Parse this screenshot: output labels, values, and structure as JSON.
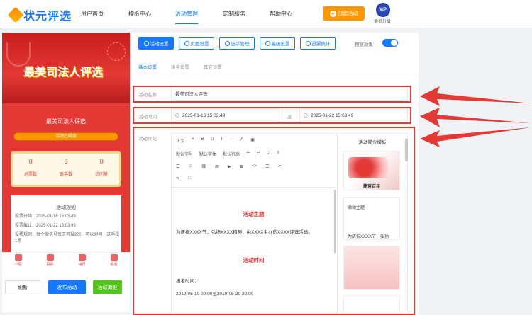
{
  "brand": {
    "name": "状元评选"
  },
  "nav": [
    "用户首页",
    "模板中心",
    "活动管理",
    "定制服务",
    "帮助中心"
  ],
  "header": {
    "create_label": "创建活动",
    "vip_badge": "VIP",
    "vip_label": "会员升级"
  },
  "preview": {
    "banner_title": "最美司法人评选",
    "card_title": "最美司法人评选",
    "status": "活动已结束",
    "stats": [
      {
        "value": "0",
        "label": "总票数"
      },
      {
        "value": "6",
        "label": "选手数"
      },
      {
        "value": "0",
        "label": "访问量"
      }
    ],
    "rules_title": "活动规则",
    "rules": [
      "投票开始：2025-01-16 15:03:49",
      "投票截止：2025-01-22 15:03:49",
      "投票规则：每个微信号每天可投2次，可以对同一选手投1票"
    ],
    "tabs": [
      "介绍",
      "投票",
      "排行",
      "报名"
    ],
    "buttons": {
      "refresh": "刷新",
      "publish": "发布活动",
      "poster": "活动海报"
    }
  },
  "toolbar": {
    "buttons": [
      "活动设置",
      "页面设置",
      "选手管理",
      "高级设置",
      "投票统计"
    ],
    "preview_toggle": "预览效果"
  },
  "subtabs": [
    "基本设置",
    "报名设置",
    "其它设置"
  ],
  "form": {
    "name_label": "活动名称",
    "name_value": "最美司法人评选",
    "time_label": "活动时间",
    "start_time": "2025-01-16 15:03:49",
    "separator": "至",
    "end_time": "2025-01-22 15:03:49",
    "intro_label": "活动介绍"
  },
  "rte": {
    "row1": [
      "正文",
      "❝",
      "B",
      "U",
      "I",
      "···",
      "A",
      "▣"
    ],
    "row2": [
      "默认字号",
      "默认字体",
      "默认行高",
      "☰",
      "☷",
      "☑",
      "≡"
    ],
    "row3": [
      "☰",
      "☺",
      "⛓",
      "▨",
      "▶",
      "▦",
      "<>",
      "☲",
      "↶"
    ],
    "row4": [
      "↷",
      "⛶"
    ],
    "heading1": "活动主题",
    "para1": "为庆祝XXXX节，弘扬XXXX精神，由XXXX主办的XXXX评选活动。",
    "heading2": "活动时间",
    "para2": "报名时间：",
    "para3": "2019-05-10 00:00至2019-05-20 20:00"
  },
  "templates": {
    "title": "活动简介模板",
    "tpl1_caption": "建营百年",
    "tpl2_title": "活动主题",
    "tpl2_body": "为庆祝XXXX节，弘扬"
  },
  "colors": {
    "accent": "#1677ff",
    "highlight": "#e53935",
    "orange": "#ff9800"
  }
}
